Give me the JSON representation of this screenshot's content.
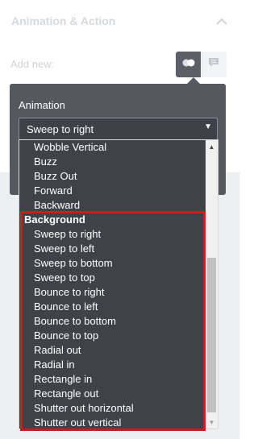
{
  "panel": {
    "title": "Animation & Action",
    "icon": "chevron-up-icon"
  },
  "add_new": {
    "label": "Add new:",
    "buttons": [
      {
        "icon": "animation-toggle-icon",
        "active": true
      },
      {
        "icon": "chat-action-icon",
        "active": false
      }
    ]
  },
  "popover": {
    "title": "Animation",
    "select": {
      "value": "Sweep to right"
    }
  },
  "dropdown": {
    "options": [
      {
        "label": "Wobble Vertical",
        "group": false
      },
      {
        "label": "Buzz",
        "group": false
      },
      {
        "label": "Buzz Out",
        "group": false
      },
      {
        "label": "Forward",
        "group": false
      },
      {
        "label": "Backward",
        "group": false
      },
      {
        "label": "Background",
        "group": true
      },
      {
        "label": "Sweep to right",
        "group": false
      },
      {
        "label": "Sweep to left",
        "group": false
      },
      {
        "label": "Sweep to bottom",
        "group": false
      },
      {
        "label": "Sweep to top",
        "group": false
      },
      {
        "label": "Bounce to right",
        "group": false
      },
      {
        "label": "Bounce to left",
        "group": false
      },
      {
        "label": "Bounce to bottom",
        "group": false
      },
      {
        "label": "Bounce to top",
        "group": false
      },
      {
        "label": "Radial out",
        "group": false
      },
      {
        "label": "Radial in",
        "group": false
      },
      {
        "label": "Rectangle in",
        "group": false
      },
      {
        "label": "Rectangle out",
        "group": false
      },
      {
        "label": "Shutter out horizontal",
        "group": false
      },
      {
        "label": "Shutter out vertical",
        "group": false
      }
    ]
  },
  "colors": {
    "highlight": "#d11a1a",
    "dropdown_bg": "#3f4248",
    "popover_bg": "#55595f"
  }
}
